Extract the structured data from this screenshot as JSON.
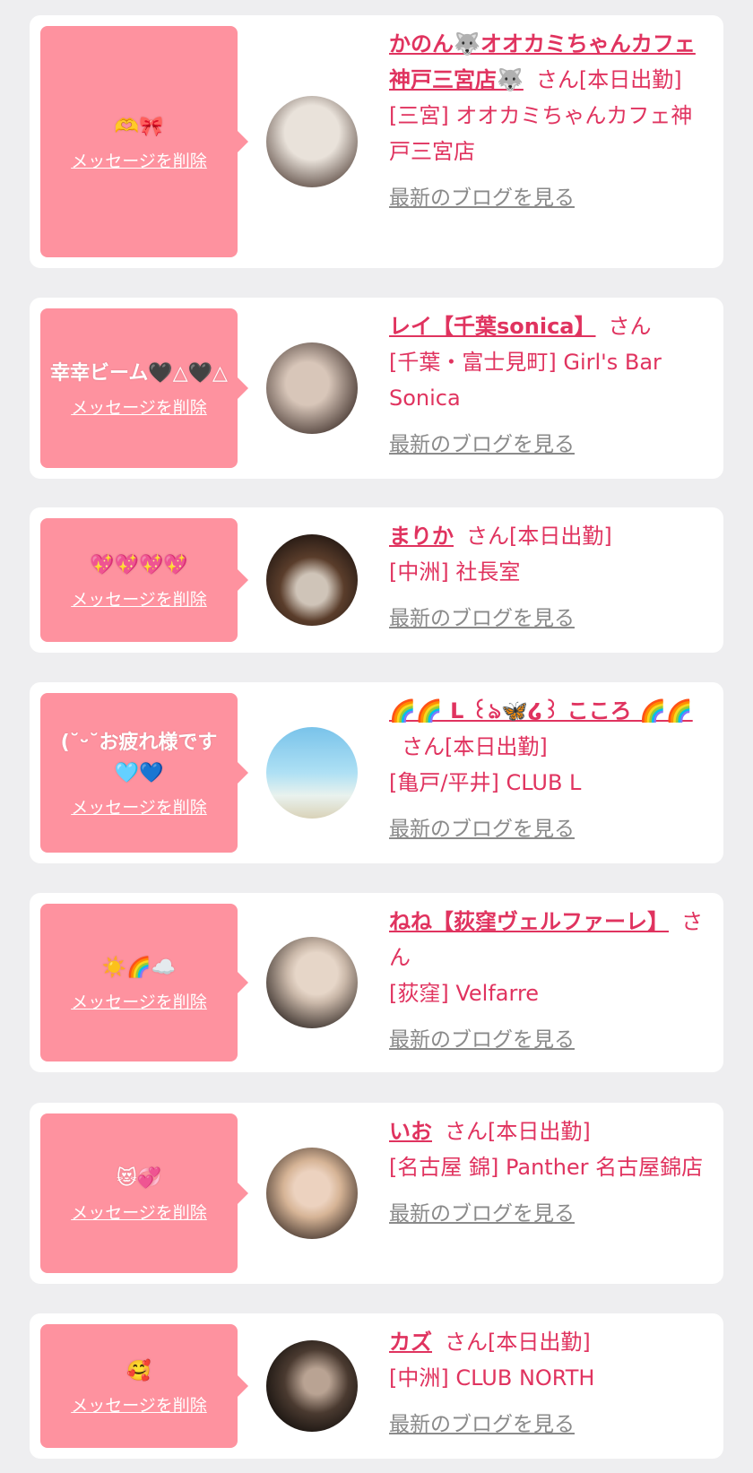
{
  "delete_label": "メッセージを削除",
  "blog_label": "最新のブログを見る",
  "san_label": "さん",
  "items": [
    {
      "message": "🫶🎀",
      "name": "かのん🐺オオカミちゃんカフェ神戸三宮店🐺",
      "status": "[本日出勤]",
      "shop": "[三宮] オオカミちゃんカフェ神戸三宮店",
      "avatar_colors": [
        "#e9e2da",
        "#7a6b63"
      ]
    },
    {
      "message": "幸幸ビーム🖤△🖤△",
      "name": "レイ【千葉sonica】",
      "status": "",
      "shop": "[千葉・富士見町] Girl's Bar Sonica",
      "avatar_colors": [
        "#d8c6b9",
        "#4a3b35"
      ]
    },
    {
      "message": "💖💖💖💖",
      "name": "まりか",
      "status": "[本日出勤]",
      "shop": "[中洲] 社長室",
      "avatar_colors": [
        "#5a3d2b",
        "#1e1410"
      ]
    },
    {
      "message": "(˘ᵕ˘お疲れ様です🩵💙",
      "name": "🌈🌈 L ꒰ঌ🦋໒꒱ こころ 🌈🌈",
      "status": "[本日出勤]",
      "shop": "[亀戸/平井] CLUB L",
      "avatar_colors": [
        "#79c3ea",
        "#e9f2ee"
      ]
    },
    {
      "message": "☀️🌈☁️",
      "name": "ねね【荻窪ヴェルファーレ】",
      "status": "",
      "shop": "[荻窪] Velfarre",
      "avatar_colors": [
        "#c9b7a8",
        "#2a221f"
      ]
    },
    {
      "message": "😻💞",
      "name": "いお",
      "status": "[本日出勤]",
      "shop": "[名古屋 錦] Panther 名古屋錦店",
      "avatar_colors": [
        "#d6b496",
        "#3b2e28"
      ]
    },
    {
      "message": "🥰",
      "name": "カズ",
      "status": "[本日出勤]",
      "shop": "[中洲] CLUB NORTH",
      "avatar_colors": [
        "#4a3a30",
        "#0e0b09"
      ]
    }
  ]
}
